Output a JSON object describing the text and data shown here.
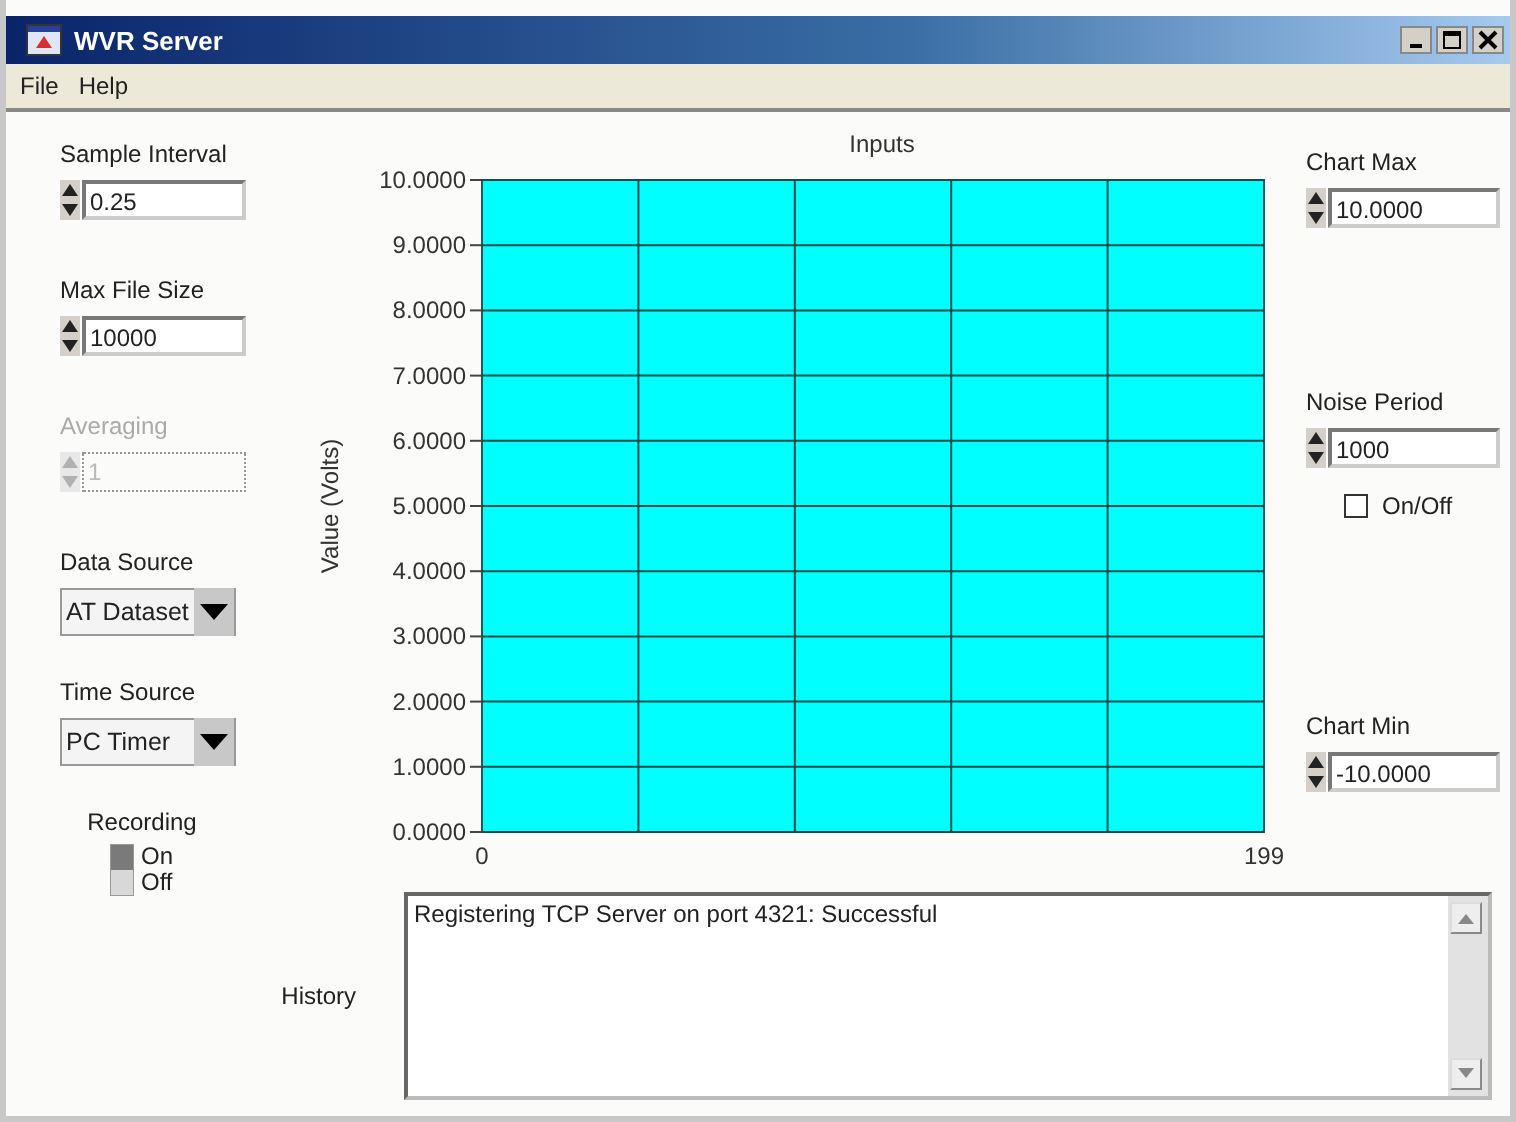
{
  "window": {
    "title": "WVR Server"
  },
  "menu": [
    {
      "label": "File"
    },
    {
      "label": "Help"
    }
  ],
  "left_controls": [
    {
      "kind": "numeric",
      "label": "Sample Interval",
      "value": "0.25",
      "disabled": false
    },
    {
      "kind": "numeric",
      "label": "Max File Size",
      "value": "10000",
      "disabled": false
    },
    {
      "kind": "numeric",
      "label": "Averaging",
      "value": "1",
      "disabled": true
    },
    {
      "kind": "dropdown",
      "label": "Data Source",
      "value": "AT Dataset"
    },
    {
      "kind": "dropdown",
      "label": "Time Source",
      "value": "PC Timer"
    },
    {
      "kind": "toggle",
      "label": "Recording",
      "on": false,
      "on_label": "On",
      "off_label": "Off"
    }
  ],
  "chart": {
    "chart_data": {
      "type": "line",
      "title": "Inputs",
      "ylabel": "Value (Volts)",
      "xlim": [
        0,
        199
      ],
      "ylim": [
        0,
        10
      ],
      "xticks": [
        0,
        199
      ],
      "grid": true,
      "yticks": [
        {
          "value": 10,
          "label": "10.0000"
        },
        {
          "value": 9,
          "label": "9.0000"
        },
        {
          "value": 8,
          "label": "8.0000"
        },
        {
          "value": 7,
          "label": "7.0000"
        },
        {
          "value": 6,
          "label": "6.0000"
        },
        {
          "value": 5,
          "label": "5.0000"
        },
        {
          "value": 4,
          "label": "4.0000"
        },
        {
          "value": 3,
          "label": "3.0000"
        },
        {
          "value": 2,
          "label": "2.0000"
        },
        {
          "value": 1,
          "label": "1.0000"
        },
        {
          "value": 0,
          "label": "0.0000"
        }
      ]
    }
  },
  "right_controls": [
    {
      "kind": "numeric",
      "label": "Chart Max",
      "value": "10.0000"
    },
    {
      "kind": "numeric",
      "label": "Noise Period",
      "value": "1000"
    },
    {
      "kind": "checkbox",
      "label": "On/Off",
      "checked": false
    },
    {
      "kind": "numeric",
      "label": "Chart Min",
      "value": "-10.0000"
    }
  ],
  "history": {
    "label": "History",
    "lines": [
      "Registering TCP Server on port 4321: Successful"
    ]
  }
}
